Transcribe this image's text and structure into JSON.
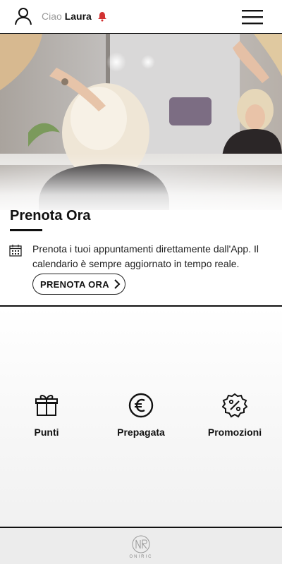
{
  "header": {
    "greeting": "Ciao",
    "user_name": "Laura",
    "icons": {
      "user": "user-icon",
      "notification": "bell-icon",
      "menu": "hamburger-menu-icon"
    },
    "notification_color": "#d23232"
  },
  "hero": {
    "image": "salon-hairdresser-photo"
  },
  "booking": {
    "title": "Prenota Ora",
    "description": "Prenota i tuoi appuntamenti direttamente dall'App. Il calendario è sempre aggiornato in tempo reale.",
    "button_label": "PRENOTA ORA",
    "icons": {
      "calendar": "calendar-icon",
      "chevron": "chevron-right-icon"
    }
  },
  "features": [
    {
      "label": "Punti",
      "icon": "gift-icon"
    },
    {
      "label": "Prepagata",
      "icon": "euro-coin-icon"
    },
    {
      "label": "Promozioni",
      "icon": "discount-badge-icon"
    }
  ],
  "footer": {
    "brand": "ONIRIC"
  }
}
